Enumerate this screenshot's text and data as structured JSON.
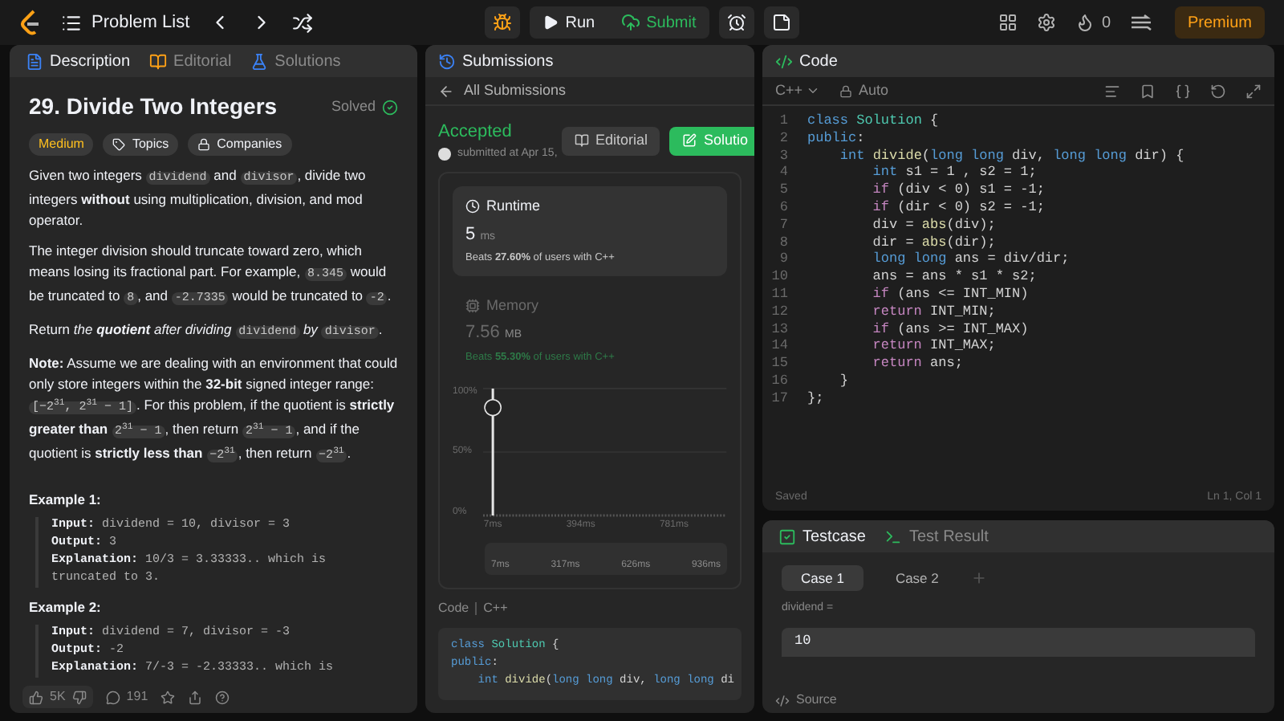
{
  "top_bar": {
    "problem_list": "Problem List",
    "run": "Run",
    "submit": "Submit",
    "streak": "0",
    "premium": "Premium"
  },
  "description_panel": {
    "tabs": [
      {
        "label": "Description",
        "selected": true,
        "kind": "description"
      },
      {
        "label": "Editorial",
        "selected": false,
        "kind": "editorial"
      },
      {
        "label": "Solutions",
        "selected": false,
        "kind": "solutions"
      }
    ],
    "title": "29. Divide Two Integers",
    "status": "Solved",
    "tags": [
      {
        "label": "Medium",
        "kind": "difficulty"
      },
      {
        "label": "Topics",
        "kind": "topics"
      },
      {
        "label": "Companies",
        "kind": "companies"
      }
    ],
    "paragraphs": [
      [
        {
          "kind": "text",
          "text": "Given two integers "
        },
        {
          "kind": "code",
          "text": "dividend"
        },
        {
          "kind": "text",
          "text": " and "
        },
        {
          "kind": "code",
          "text": "divisor"
        },
        {
          "kind": "text",
          "text": ", divide two integers **without** using multiplication, division, and mod operator."
        }
      ],
      [
        {
          "kind": "text",
          "text": "The integer division should truncate toward zero, which means losing its fractional part. For example, "
        },
        {
          "kind": "code",
          "text": "8.345"
        },
        {
          "kind": "text",
          "text": " would be truncated to "
        },
        {
          "kind": "code",
          "text": "8"
        },
        {
          "kind": "text",
          "text": ", and "
        },
        {
          "kind": "code",
          "text": "-2.7335"
        },
        {
          "kind": "text",
          "text": " would be truncated to "
        },
        {
          "kind": "code",
          "text": "-2"
        },
        {
          "kind": "text",
          "text": "."
        }
      ],
      [
        {
          "kind": "text",
          "text": "Return *the* "
        },
        {
          "kind": "strong_em",
          "text": "quotient"
        },
        {
          "kind": "text",
          "text": " *after dividing* "
        },
        {
          "kind": "code",
          "text": "dividend"
        },
        {
          "kind": "text",
          "text": " *by* "
        },
        {
          "kind": "code",
          "text": "divisor"
        },
        {
          "kind": "text",
          "text": "."
        }
      ],
      [
        {
          "kind": "text",
          "text": "**Note:** Assume we are dealing with an environment that could only store integers within the **32-bit** signed integer range: "
        },
        {
          "kind": "code",
          "text": "[−2$^{31}$, 2$^{31}$ − 1]"
        },
        {
          "kind": "text",
          "text": ". For this problem, if the quotient is **strictly greater than** "
        },
        {
          "kind": "code",
          "text": "2$^{31}$ − 1"
        },
        {
          "kind": "text",
          "text": ", then return "
        },
        {
          "kind": "code",
          "text": "2$^{31}$ − 1"
        },
        {
          "kind": "text",
          "text": ", and if the quotient is **strictly less than** "
        },
        {
          "kind": "code",
          "text": "−2$^{31}$"
        },
        {
          "kind": "text",
          "text": ", then return "
        },
        {
          "kind": "code",
          "text": "−2$^{31}$"
        },
        {
          "kind": "text",
          "text": "."
        }
      ]
    ],
    "examples": [
      {
        "title": "Example 1:",
        "lines": [
          {
            "label": "Input:",
            "value": "dividend = 10, divisor = 3"
          },
          {
            "label": "Output:",
            "value": "3"
          },
          {
            "label": "Explanation:",
            "value": "10/3 = 3.33333.. which is truncated to 3."
          }
        ]
      },
      {
        "title": "Example 2:",
        "lines": [
          {
            "label": "Input:",
            "value": "dividend = 7, divisor = -3"
          },
          {
            "label": "Output:",
            "value": "-2"
          },
          {
            "label": "Explanation:",
            "value": "7/-3 = -2.33333.. which is"
          }
        ]
      }
    ],
    "footer": {
      "likes": "5K",
      "comments": "191"
    }
  },
  "submissions_panel": {
    "tab": "Submissions",
    "back": "All Submissions",
    "status": "Accepted",
    "submitted": "submitted at Apr 15,",
    "buttons": [
      {
        "label": "Editorial",
        "kind": "secondary"
      },
      {
        "label": "Solutio",
        "kind": "primary"
      }
    ],
    "metrics": [
      {
        "kind": "runtime",
        "label": "Runtime",
        "selected": true,
        "value": "5",
        "unit": "ms",
        "beats": "Beats **27.60%** of users with C++"
      },
      {
        "kind": "memory",
        "label": "Memory",
        "selected": false,
        "value": "7.56",
        "unit": "MB",
        "beats": "Beats **55.30%** of users with C++"
      }
    ],
    "chart": {
      "y_labels": [
        "100%",
        "50%",
        "0%"
      ],
      "x_labels": [
        "7ms",
        "394ms",
        "781ms"
      ],
      "range_labels": [
        "7ms",
        "317ms",
        "626ms",
        "936ms"
      ]
    },
    "code_header": "Code",
    "code_language": "C++",
    "code_preview": [
      {
        "tokens": [
          {
            "kind": "kw",
            "text": "class "
          },
          {
            "kind": "cls",
            "text": "Solution"
          },
          {
            "kind": "plain",
            "text": " {"
          }
        ]
      },
      {
        "tokens": [
          {
            "kind": "kw",
            "text": "public"
          },
          {
            "kind": "plain",
            "text": ":"
          }
        ]
      },
      {
        "tokens": [
          {
            "kind": "kw",
            "text": "    int "
          },
          {
            "kind": "fn",
            "text": "divide"
          },
          {
            "kind": "plain",
            "text": "("
          },
          {
            "kind": "kw",
            "text": "long long "
          },
          {
            "kind": "plain",
            "text": "div, "
          },
          {
            "kind": "kw",
            "text": "long long "
          },
          {
            "kind": "plain",
            "text": "di"
          }
        ]
      }
    ]
  },
  "editor": {
    "tab": "Code",
    "language": "C++",
    "mode": "Auto",
    "status": "Saved",
    "cursor": "Ln 1, Col 1",
    "lines": [
      {
        "number": "1",
        "tokens": [
          {
            "kind": "kw",
            "text": "class "
          },
          {
            "kind": "cls",
            "text": "Solution"
          },
          {
            "kind": "plain",
            "text": " {"
          }
        ]
      },
      {
        "number": "2",
        "tokens": [
          {
            "kind": "kw",
            "text": "public"
          },
          {
            "kind": "plain",
            "text": ":"
          }
        ]
      },
      {
        "number": "3",
        "tokens": [
          {
            "kind": "kw",
            "text": "    int "
          },
          {
            "kind": "fn",
            "text": "divide"
          },
          {
            "kind": "plain",
            "text": "("
          },
          {
            "kind": "kw",
            "text": "long long "
          },
          {
            "kind": "plain",
            "text": "div, "
          },
          {
            "kind": "kw",
            "text": "long long "
          },
          {
            "kind": "plain",
            "text": "dir) {"
          }
        ]
      },
      {
        "number": "4",
        "tokens": [
          {
            "kind": "kw",
            "text": "        int "
          },
          {
            "kind": "plain",
            "text": "s1 = 1 , s2 = 1;"
          }
        ]
      },
      {
        "number": "5",
        "tokens": [
          {
            "kind": "ctrl",
            "text": "        if "
          },
          {
            "kind": "plain",
            "text": "(div < 0) s1 = -1;"
          }
        ]
      },
      {
        "number": "6",
        "tokens": [
          {
            "kind": "ctrl",
            "text": "        if "
          },
          {
            "kind": "plain",
            "text": "(dir < 0) s2 = -1;"
          }
        ]
      },
      {
        "number": "7",
        "tokens": [
          {
            "kind": "plain",
            "text": "        div = "
          },
          {
            "kind": "fn",
            "text": "abs"
          },
          {
            "kind": "plain",
            "text": "(div);"
          }
        ]
      },
      {
        "number": "8",
        "tokens": [
          {
            "kind": "plain",
            "text": "        dir = "
          },
          {
            "kind": "fn",
            "text": "abs"
          },
          {
            "kind": "plain",
            "text": "(dir);"
          }
        ]
      },
      {
        "number": "9",
        "tokens": [
          {
            "kind": "kw",
            "text": "        long long "
          },
          {
            "kind": "plain",
            "text": "ans = div/dir;"
          }
        ]
      },
      {
        "number": "10",
        "tokens": [
          {
            "kind": "plain",
            "text": "        ans = ans * s1 * s2;"
          }
        ]
      },
      {
        "number": "11",
        "tokens": [
          {
            "kind": "ctrl",
            "text": "        if "
          },
          {
            "kind": "plain",
            "text": "(ans <= INT_MIN)"
          }
        ]
      },
      {
        "number": "12",
        "tokens": [
          {
            "kind": "ctrl",
            "text": "        return "
          },
          {
            "kind": "plain",
            "text": "INT_MIN;"
          }
        ]
      },
      {
        "number": "13",
        "tokens": [
          {
            "kind": "ctrl",
            "text": "        if "
          },
          {
            "kind": "plain",
            "text": "(ans >= INT_MAX)"
          }
        ]
      },
      {
        "number": "14",
        "tokens": [
          {
            "kind": "ctrl",
            "text": "        return "
          },
          {
            "kind": "plain",
            "text": "INT_MAX;"
          }
        ]
      },
      {
        "number": "15",
        "tokens": [
          {
            "kind": "ctrl",
            "text": "        return "
          },
          {
            "kind": "plain",
            "text": "ans;"
          }
        ]
      },
      {
        "number": "16",
        "tokens": [
          {
            "kind": "plain",
            "text": "    }"
          }
        ]
      },
      {
        "number": "17",
        "tokens": [
          {
            "kind": "plain",
            "text": "};"
          }
        ]
      }
    ]
  },
  "testcase_panel": {
    "tabs": [
      {
        "label": "Testcase",
        "selected": true,
        "kind": "testcase"
      },
      {
        "label": "Test Result",
        "selected": false,
        "kind": "result"
      }
    ],
    "cases": [
      {
        "label": "Case 1",
        "selected": true
      },
      {
        "label": "Case 2",
        "selected": false
      }
    ],
    "param": "dividend =",
    "value": "10",
    "source": "Source"
  }
}
